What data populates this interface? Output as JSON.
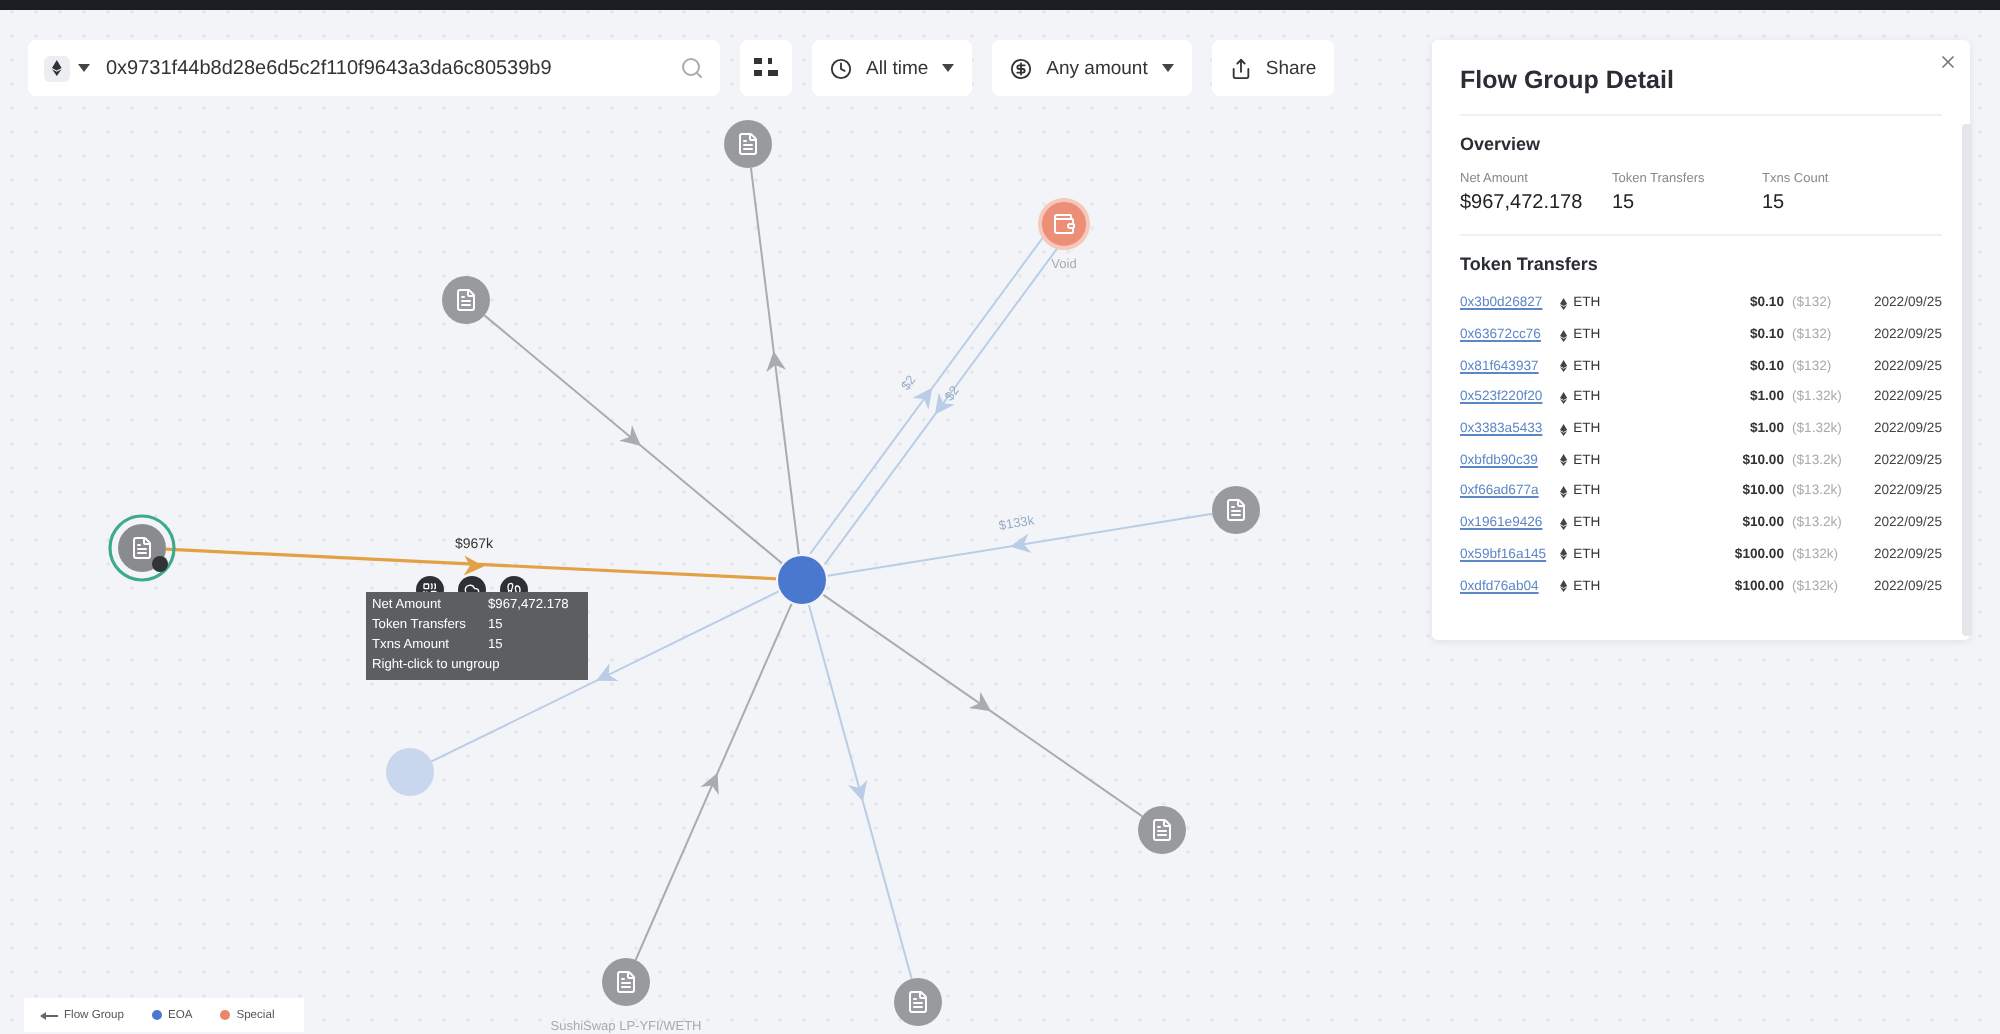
{
  "search": {
    "value": "0x9731f44b8d28e6d5c2f110f9643a3da6c80539b9"
  },
  "filters": [
    {
      "kind": "time",
      "label": "All time"
    },
    {
      "kind": "amount",
      "label": "Any amount"
    }
  ],
  "share_button": {
    "label": "Share"
  },
  "graph": {
    "nodes": [
      {
        "kind": "eoa",
        "faded": false,
        "selected": false
      },
      {
        "kind": "contract",
        "faded": false,
        "selected": false,
        "edges": [
          {
            "toward_center": false,
            "faded": false
          }
        ]
      },
      {
        "kind": "contract",
        "faded": false,
        "selected": false,
        "edges": [
          {
            "toward_center": true,
            "faded": false
          }
        ]
      },
      {
        "kind": "special",
        "label": "Void",
        "faded": false,
        "selected": false,
        "edges": [
          {
            "toward_center": false,
            "faded": true,
            "label": "$2"
          },
          {
            "toward_center": true,
            "faded": true,
            "label": "$2"
          }
        ]
      },
      {
        "kind": "contract",
        "faded": false,
        "selected": false,
        "edges": [
          {
            "toward_center": true,
            "faded": true,
            "label": "$133k"
          }
        ]
      },
      {
        "kind": "flow_group",
        "faded": false,
        "selected": true,
        "edges": [
          {
            "toward_center": true,
            "highlighted": true,
            "label": "$967k"
          }
        ]
      },
      {
        "kind": "eoa",
        "faded": true,
        "selected": false,
        "edges": [
          {
            "toward_center": false,
            "faded": true
          }
        ]
      },
      {
        "kind": "contract",
        "faded": false,
        "selected": false,
        "edges": [
          {
            "toward_center": false,
            "faded": false
          }
        ]
      },
      {
        "kind": "contract",
        "faded": false,
        "selected": false,
        "edges": [
          {
            "toward_center": false,
            "faded": true
          }
        ]
      },
      {
        "kind": "contract",
        "label": "SushiSwap LP-YFI/WETH",
        "faded": false,
        "selected": false,
        "edges": [
          {
            "toward_center": true,
            "faded": false
          }
        ]
      }
    ]
  },
  "tooltip": {
    "rows": [
      {
        "label": "Net Amount",
        "value": "$967,472.178"
      },
      {
        "label": "Token Transfers",
        "value": "15"
      },
      {
        "label": "Txns Amount",
        "value": "15"
      }
    ],
    "hint": "Right-click to ungroup"
  },
  "legend": [
    {
      "kind": "line",
      "label": "Flow Group"
    },
    {
      "kind": "dot",
      "label": "EOA",
      "color": "#4a78cf"
    },
    {
      "kind": "dot",
      "label": "Special",
      "color": "#e8866a"
    }
  ],
  "panel": {
    "title": "Flow Group Detail",
    "overview_title": "Overview",
    "stats": [
      {
        "label": "Net Amount",
        "value": "$967,472.178"
      },
      {
        "label": "Token Transfers",
        "value": "15"
      },
      {
        "label": "Txns Count",
        "value": "15"
      }
    ],
    "transfers_title": "Token Transfers",
    "transfers": [
      {
        "hash": "0x3b0d26827",
        "token": "ETH",
        "amount": "$0.10",
        "usd": "($132)",
        "date": "2022/09/25"
      },
      {
        "hash": "0x63672cc76",
        "token": "ETH",
        "amount": "$0.10",
        "usd": "($132)",
        "date": "2022/09/25"
      },
      {
        "hash": "0x81f643937",
        "token": "ETH",
        "amount": "$0.10",
        "usd": "($132)",
        "date": "2022/09/25"
      },
      {
        "hash": "0x523f220f20",
        "token": "ETH",
        "amount": "$1.00",
        "usd": "($1.32k)",
        "date": "2022/09/25"
      },
      {
        "hash": "0x3383a5433",
        "token": "ETH",
        "amount": "$1.00",
        "usd": "($1.32k)",
        "date": "2022/09/25"
      },
      {
        "hash": "0xbfdb90c39",
        "token": "ETH",
        "amount": "$10.00",
        "usd": "($13.2k)",
        "date": "2022/09/25"
      },
      {
        "hash": "0xf66ad677a",
        "token": "ETH",
        "amount": "$10.00",
        "usd": "($13.2k)",
        "date": "2022/09/25"
      },
      {
        "hash": "0x1961e9426",
        "token": "ETH",
        "amount": "$10.00",
        "usd": "($13.2k)",
        "date": "2022/09/25"
      },
      {
        "hash": "0x59bf16a145",
        "token": "ETH",
        "amount": "$100.00",
        "usd": "($132k)",
        "date": "2022/09/25"
      },
      {
        "hash": "0xdfd76ab04",
        "token": "ETH",
        "amount": "$100.00",
        "usd": "($132k)",
        "date": "2022/09/25"
      }
    ]
  }
}
